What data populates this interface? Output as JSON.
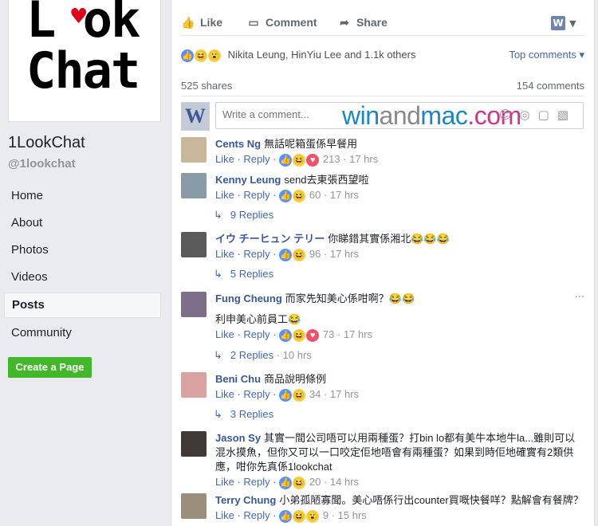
{
  "sidebar": {
    "logo_text_line1": "L ok",
    "logo_text_line2": "Chat",
    "page_name": "1LookChat",
    "handle": "@1lookchat",
    "nav": [
      "Home",
      "About",
      "Photos",
      "Videos",
      "Posts",
      "Community"
    ],
    "active_nav": "Posts",
    "create_page": "Create a Page"
  },
  "actions": {
    "like": "Like",
    "comment": "Comment",
    "share": "Share"
  },
  "reactions": {
    "summary": "Nikita Leung, HinYiu Lee and 1.1k others",
    "top_comments": "Top comments ▾",
    "shares": "525 shares",
    "comments_count": "154 comments"
  },
  "composer": {
    "placeholder": "Write a comment...",
    "watermark_a": "win",
    "watermark_b": "and",
    "watermark_c": "mac",
    "watermark_d": ".com"
  },
  "comments": [
    {
      "name": "Cents Ng",
      "text": "無話呢箱蛋係早餐用",
      "like": "Like",
      "reply": "Reply",
      "count": "213",
      "time": "17 hrs"
    },
    {
      "name": "Kenny Leung",
      "text": "send去東張西望啦",
      "like": "Like",
      "reply": "Reply",
      "count": "60",
      "time": "17 hrs",
      "replies": "9 Replies"
    },
    {
      "name": "イウ チーヒュン テリー",
      "text": "你睇錯其實係湘北😂😂😂",
      "like": "Like",
      "reply": "Reply",
      "count": "96",
      "time": "17 hrs",
      "replies": "5 Replies"
    },
    {
      "name": "Fung Cheung",
      "text": "而家先知美心係咁啊？😂😂",
      "text2": "利申美心前員工😂",
      "like": "Like",
      "reply": "Reply",
      "count": "73",
      "time": "17 hrs",
      "replies": "2 Replies",
      "replies_time": "10 hrs"
    },
    {
      "name": "Beni Chu",
      "text": "商品說明條例",
      "like": "Like",
      "reply": "Reply",
      "count": "34",
      "time": "17 hrs",
      "replies": "3 Replies"
    },
    {
      "name": "Jason Sy",
      "text": "其實一間公司唔可以用兩種蛋？打bin lo都有美牛本地牛la...雖則可以混水摸魚，但你又可以一口咬定佢地唔會有兩種蛋？如果到時佢地確實有2類供應，咁你先真係1lookchat",
      "like": "Like",
      "reply": "Reply",
      "count": "20",
      "time": "14 hrs"
    },
    {
      "name": "Terry Chung",
      "text": "小弟孤陋寡聞。美心唔係行出counter買嘅快餐咩？點解會有餐牌？",
      "like": "Like",
      "reply": "Reply",
      "count": "9",
      "time": "15 hrs"
    }
  ]
}
